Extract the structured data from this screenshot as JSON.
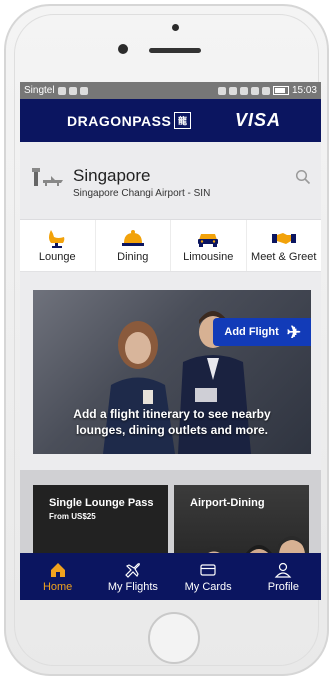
{
  "status": {
    "carrier": "Singtel",
    "time": "15:03"
  },
  "header": {
    "brand": "DRAGONPASS",
    "partner": "VISA"
  },
  "location": {
    "city": "Singapore",
    "airport": "Singapore Changi Airport - SIN"
  },
  "categories": [
    {
      "label": "Lounge",
      "icon": "lounge-chair-icon"
    },
    {
      "label": "Dining",
      "icon": "cloche-icon"
    },
    {
      "label": "Limousine",
      "icon": "car-icon"
    },
    {
      "label": "Meet & Greet",
      "icon": "handshake-icon"
    }
  ],
  "banner": {
    "button_label": "Add Flight",
    "text": "Add a flight itinerary to see nearby lounges, dining outlets and more."
  },
  "promos": [
    {
      "title": "Single Lounge Pass",
      "subtitle": "From US$25"
    },
    {
      "title": "Airport-Dining",
      "subtitle": ""
    }
  ],
  "nav": [
    {
      "label": "Home",
      "icon": "home-icon",
      "active": true
    },
    {
      "label": "My Flights",
      "icon": "plane-icon",
      "active": false
    },
    {
      "label": "My Cards",
      "icon": "card-icon",
      "active": false
    },
    {
      "label": "Profile",
      "icon": "person-icon",
      "active": false
    }
  ],
  "colors": {
    "navy": "#0b1560",
    "accent": "#f0a21e",
    "button_blue": "#123bb8"
  }
}
